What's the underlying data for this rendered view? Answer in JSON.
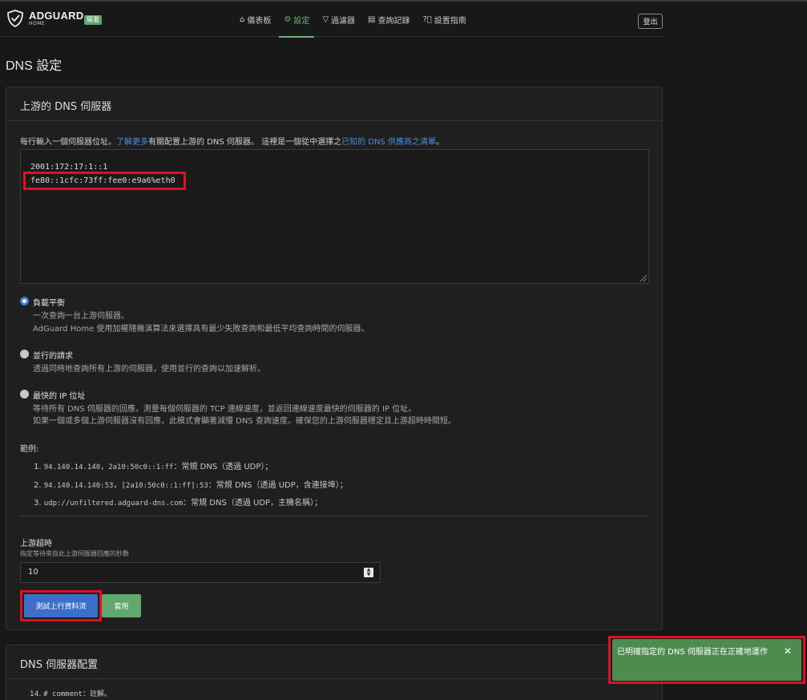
{
  "app": {
    "brand": "ADGUARD",
    "brand_sub": "HOME",
    "badge": "開著",
    "logout": "登出"
  },
  "nav": [
    {
      "label": "儀表板",
      "icon": "home-icon"
    },
    {
      "label": "設定",
      "icon": "gear-icon",
      "active": true
    },
    {
      "label": "過濾器",
      "icon": "filter-icon"
    },
    {
      "label": "查詢記錄",
      "icon": "log-icon"
    },
    {
      "label": "設置指南",
      "icon": "help-icon"
    }
  ],
  "page": {
    "title": "DNS 設定"
  },
  "upstream": {
    "title": "上游的 DNS 伺服器",
    "intro_a": "每行輸入一個伺服器位址。",
    "intro_link1": "了解更多",
    "intro_b": "有關配置上游的 DNS 伺服器。 這裡是一個從中選擇之",
    "intro_link2": "已知的 DNS 供應商之清單",
    "intro_c": "。",
    "servers": [
      "2001:172:17:1::1",
      "fe80::1cfc:73ff:fee0:e9a6%eth0"
    ],
    "modes": [
      {
        "label": "負載平衡",
        "desc": [
          "一次查詢一台上游伺服器。",
          "AdGuard Home 使用加權隨機演算法來選擇具有最少失敗查詢和最低平均查詢時間的伺服器。"
        ],
        "selected": true
      },
      {
        "label": "並行的請求",
        "desc": [
          "透過同時地查詢所有上游的伺服器，使用並行的查詢以加速解析。"
        ],
        "selected": false
      },
      {
        "label": "最快的 IP 位址",
        "desc": [
          "等待所有 DNS 伺服器的回應，測量每個伺服器的 TCP 連線速度，並返回連線速度最快的伺服器的 IP 位址。",
          "如果一個或多個上游伺服器沒有回應，此模式會顯著減慢 DNS 查詢速度。確保您的上游伺服器穩定且上游超時時間短。"
        ],
        "selected": false
      }
    ],
    "examples_title": "範例:",
    "examples": [
      {
        "num": "1.",
        "code": "94.140.14.140",
        "sep": "，",
        "code2": "2a10:50c0::1:ff",
        "text": "：常規 DNS（透過 UDP）；"
      },
      {
        "num": "2.",
        "code": "94.140.14.140:53",
        "sep": "，",
        "code2": "[2a10:50c0::1:ff]:53",
        "text": "：常規 DNS（透過 UDP，含連接埠）；"
      },
      {
        "num": "3.",
        "code": "udp://unfiltered.adguard-dns.com",
        "sep": "",
        "code2": "",
        "text": "：常規 DNS（透過 UDP，主機名稱）；"
      }
    ],
    "timeout_label": "上游超時",
    "timeout_hint": "指定等待來自此上游伺服器回應的秒數",
    "timeout_value": "10",
    "test_button": "測試上行資料流",
    "apply_button": "套用"
  },
  "server_config": {
    "title": "DNS 伺服器配置",
    "line_num": "14.",
    "line_code": "# comment",
    "line_text": "：註解。"
  },
  "toast": {
    "message": "已明確指定的 DNS 伺服器正在正確地運作",
    "close": "✕"
  }
}
